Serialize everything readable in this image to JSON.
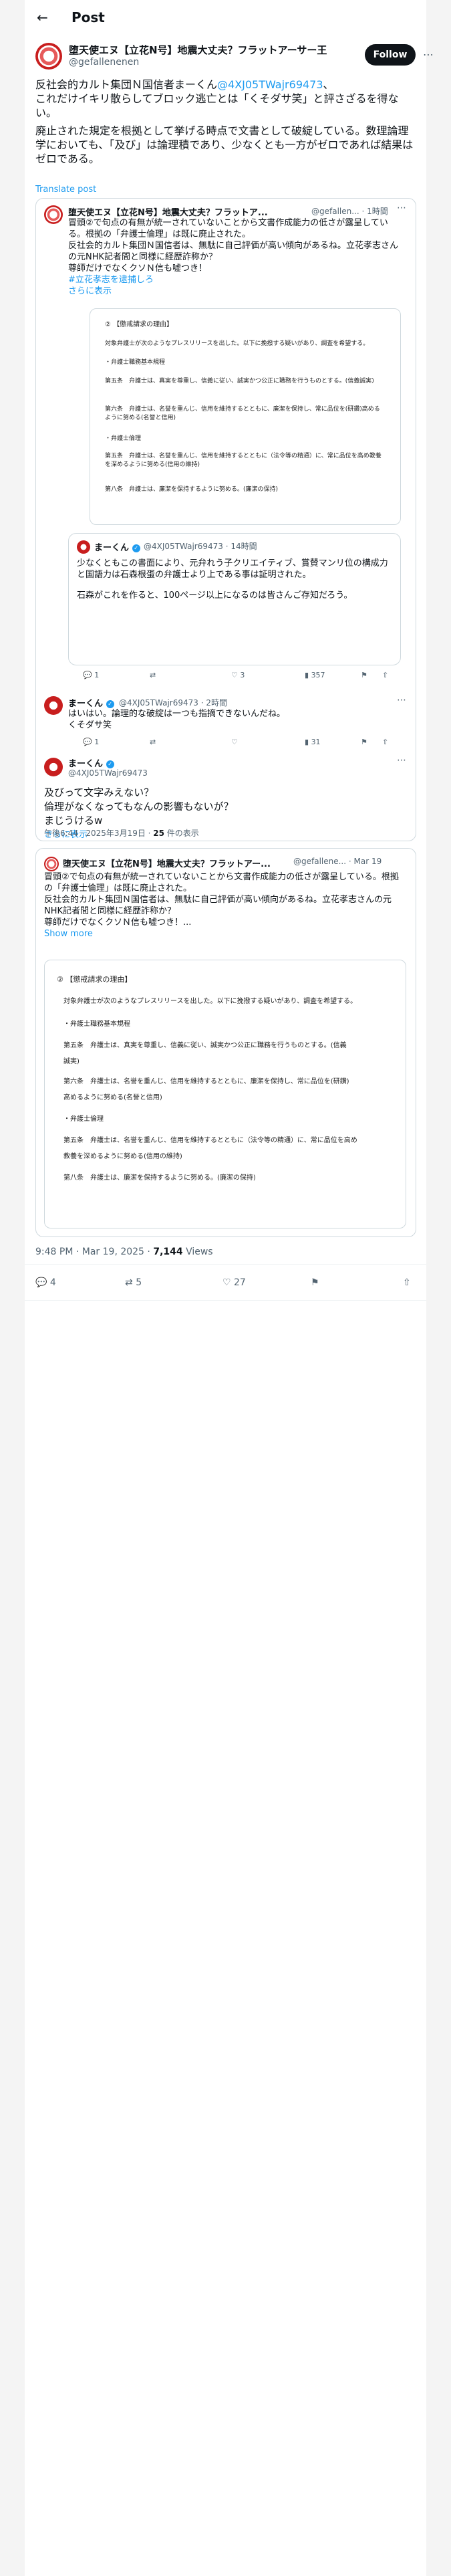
{
  "header": {
    "title": "Post",
    "back_icon": "←"
  },
  "author": {
    "name": "堕天使エヌ【立花N号】地震大丈夫？フラットアーサー王",
    "handle": "@gefallenenen",
    "follow_label": "Follow"
  },
  "post": {
    "lines": [
      "反社会的カルト集団Ｎ国信者まーくん",
      "これだけイキリ散らしてブロック逃亡とは「くそダサ笑」と評さざるを得ない。",
      "廃止された規定を根拠として挙げる時点で文書として破綻している。数理論理学においても、「及び」は論理積であり、少なくとも一方がゼロであれば結果はゼロである。"
    ],
    "mention": "@4XJ05TWajr69473",
    "mention_suffix": "、",
    "translate_label": "Translate post"
  },
  "screenshot1": {
    "tweet": {
      "name": "堕天使エヌ【立花N号】地震大丈夫？フラットア...",
      "handle": "@gefallen... · 1時間",
      "lines": [
        "冒頭②で句点の有無が統一されていないことから文書作成能力の低さが露呈している。根拠の「弁護士倫理」は既に廃止された。",
        "反社会的カルト集団Ｎ国信者は、無駄に自己評価が高い傾向があるね。立花孝志さんの元NHK記者間と同様に経歴詐称か？",
        "尊師だけでなくクソＮ信も嘘つき！"
      ],
      "hashtag": "#立花孝志を逮捕しろ",
      "show_more": "さらに表示"
    },
    "doc_lines": [
      "② 【懲戒請求の理由】",
      "対象弁護士が次のようなプレスリリースを出した。以下に挽撥する疑いがあり、調査を希望する。",
      "・弁護士職務基本規程",
      "第五条　弁護士は、真実を尊重し、信義に従い、誠実かつ公正に職務を行うものとする。(信義誠実)",
      "第六条　弁護士は、名誉を重んじ、信用を維持するとともに、廉潔を保持し、常に品位を(研鑽)高めるように努める(名誉と信用)",
      "・弁護士倫理",
      "第五条　弁護士は、名誉を重んじ、信用を維持するとともに（法令等の精通）に、常に品位を高め教養を深めるように努める(信用の維持)",
      "第八条　弁護士は、廉潔を保持するように努める。(廉潔の保持)"
    ],
    "quote": {
      "name": "まーくん",
      "handle": "@4XJ05TWajr69473 · 14時間",
      "lines": [
        "少なくともこの書面により、元弁れう子クリエイティブ、賞賛マンリ位の構成力と国語力は石森根蛋の弁護士より上である事は証明された。",
        "石森がこれを作ると、100ページ以上になるのは皆さんご存知だろう。"
      ]
    },
    "actions1": {
      "reply": "1",
      "retweet": "",
      "like": "3",
      "views": "357"
    },
    "reply1": {
      "name": "まーくん",
      "handle": "@4XJ05TWajr69473 · 2時間",
      "lines": [
        "はいはい。論理的な破綻は一つも指摘できないんだね。",
        "くそダサ笑"
      ]
    },
    "actions2": {
      "reply": "1",
      "retweet": "",
      "like": "",
      "views": "31"
    },
    "reply2": {
      "name": "まーくん",
      "handle": "@4XJ05TWajr69473",
      "lines": [
        "及びって文字みえない？",
        "倫理がなくなってもなんの影響もないが？",
        "まじうけるw"
      ],
      "show_more": "さらに表示"
    },
    "footer": "午後6:44 · 2025年3月19日 · ",
    "footer_views": "25",
    "footer_views_suffix": " 件の表示"
  },
  "screenshot2": {
    "name": "堕天使エヌ【立花N号】地震大丈夫？フラットアー...",
    "handle": "@gefallene... · Mar 19",
    "lines": [
      "冒頭②で句点の有無が統一されていないことから文書作成能力の低さが露呈している。根拠の「弁護士倫理」は既に廃止された。",
      "反社会的カルト集団Ｎ国信者は、無駄に自己評価が高い傾向があるね。立花孝志さんの元NHK記者間と同様に経歴詐称か？",
      "尊師だけでなくクソＮ信も嘘つき！..."
    ],
    "show_more": "Show more",
    "doc_lines": [
      "② 【懲戒請求の理由】",
      "対象弁護士が次のようなプレスリリースを出した。以下に挽撥する疑いがあり、調査を希望する。",
      "・弁護士職務基本規程",
      "第五条　弁護士は、真実を尊重し、信義に従い、誠実かつ公正に職務を行うものとする。(信義",
      "誠実)",
      "第六条　弁護士は、名誉を重んじ、信用を維持するとともに、廉潔を保持し、常に品位を(研鑽)",
      "高めるように努める(名誉と信用)",
      "・弁護士倫理",
      "第五条　弁護士は、名誉を重んじ、信用を維持するとともに（法令等の精通）に、常に品位を高め",
      "教養を深めるように努める(信用の維持)",
      "第八条　弁護士は、廉潔を保持するように努める。(廉潔の保持)"
    ]
  },
  "meta": {
    "time": "9:48 PM · Mar 19, 2025 · ",
    "views": "7,144",
    "views_label": " Views"
  },
  "actions": {
    "reply": "4",
    "retweet": "5",
    "like": "27"
  }
}
